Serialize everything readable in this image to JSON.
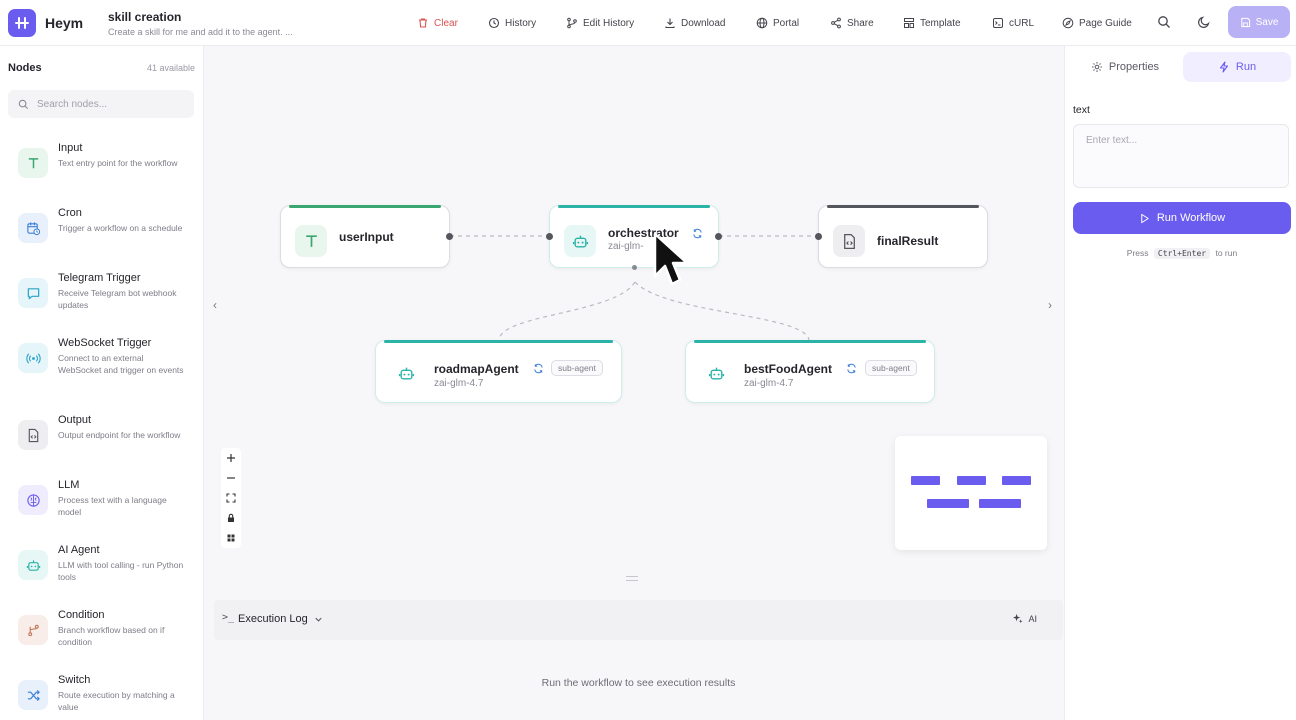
{
  "app": {
    "name": "Heym"
  },
  "workflow": {
    "title": "skill creation",
    "description": "Create a skill for me and add it to the agent. ..."
  },
  "toolbar": {
    "clear": "Clear",
    "history": "History",
    "edit_history": "Edit History",
    "download": "Download",
    "portal": "Portal",
    "share": "Share",
    "template": "Template",
    "curl": "cURL",
    "page_guide": "Page Guide",
    "save": "Save"
  },
  "sidebar": {
    "title": "Nodes",
    "count": "41 available",
    "search_placeholder": "Search nodes...",
    "items": [
      {
        "name": "Input",
        "desc": "Text entry point for the workflow",
        "icon": "text-icon",
        "color": "#3aa672",
        "bg": "#e8f6ee"
      },
      {
        "name": "Cron",
        "desc": "Trigger a workflow on a schedule",
        "icon": "calendar-clock-icon",
        "color": "#3b7fd9",
        "bg": "#e8f0fb"
      },
      {
        "name": "Telegram Trigger",
        "desc": "Receive Telegram bot webhook updates",
        "icon": "chat-icon",
        "color": "#2ba3c7",
        "bg": "#e6f5fa"
      },
      {
        "name": "WebSocket Trigger",
        "desc": "Connect to an external WebSocket and trigger on events",
        "icon": "radio-waves-icon",
        "color": "#2ba3c7",
        "bg": "#e6f5fa"
      },
      {
        "name": "Output",
        "desc": "Output endpoint for the workflow",
        "icon": "code-file-icon",
        "color": "#55555d",
        "bg": "#eeeef1"
      },
      {
        "name": "LLM",
        "desc": "Process text with a language model",
        "icon": "brain-icon",
        "color": "#6b5cf0",
        "bg": "#efedfd"
      },
      {
        "name": "AI Agent",
        "desc": "LLM with tool calling - run Python tools",
        "icon": "robot-icon",
        "color": "#2bb3a8",
        "bg": "#e6f7f5"
      },
      {
        "name": "Condition",
        "desc": "Branch workflow based on if condition",
        "icon": "branch-icon",
        "color": "#c4795a",
        "bg": "#f8ede8"
      },
      {
        "name": "Switch",
        "desc": "Route execution by matching a value",
        "icon": "shuffle-icon",
        "color": "#3b7fd9",
        "bg": "#e8f0fb"
      }
    ]
  },
  "canvas": {
    "nodes": {
      "user_input": {
        "name": "userInput"
      },
      "orchestrator": {
        "name": "orchestrator",
        "model": "zai-glm-"
      },
      "final_result": {
        "name": "finalResult"
      },
      "roadmap_agent": {
        "name": "roadmapAgent",
        "model": "zai-glm-4.7",
        "badge": "sub-agent"
      },
      "best_food_agent": {
        "name": "bestFoodAgent",
        "model": "zai-glm-4.7",
        "badge": "sub-agent"
      }
    }
  },
  "log": {
    "prompt": ">_",
    "title": "Execution Log",
    "ai": "AI",
    "empty": "Run the workflow to see execution results"
  },
  "right_panel": {
    "tab_properties": "Properties",
    "tab_run": "Run",
    "field_label": "text",
    "field_placeholder": "Enter text...",
    "run_button": "Run Workflow",
    "hint_prefix": "Press",
    "hint_keys": "Ctrl+Enter",
    "hint_suffix": "to run"
  },
  "colors": {
    "accent": "#6b5cf0",
    "input_green": "#3aa672",
    "agent_teal": "#2bb3a8",
    "danger": "#d9534f"
  }
}
